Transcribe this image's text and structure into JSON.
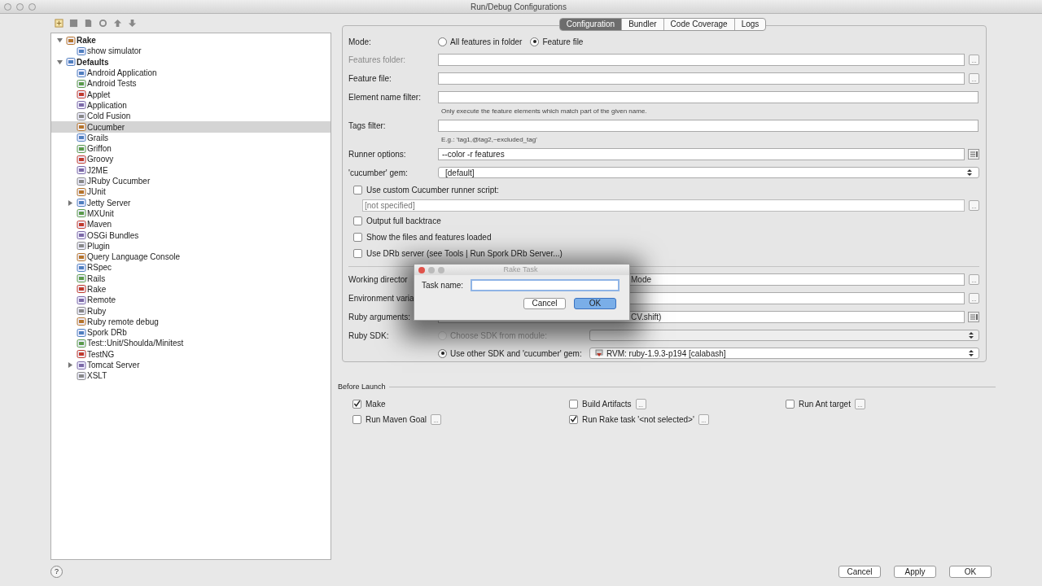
{
  "window": {
    "title": "Run/Debug Configurations"
  },
  "tree": [
    {
      "label": "Rake",
      "kind": "group",
      "expanded": true,
      "bold": true,
      "selected": false,
      "children": [
        {
          "label": "show simulator",
          "kind": "leaf",
          "selected": false
        }
      ]
    },
    {
      "label": "Defaults",
      "kind": "group",
      "expanded": true,
      "bold": true,
      "selected": false,
      "children": [
        {
          "label": "Android Application",
          "kind": "leaf",
          "selected": false
        },
        {
          "label": "Android Tests",
          "kind": "leaf",
          "selected": false
        },
        {
          "label": "Applet",
          "kind": "leaf",
          "selected": false
        },
        {
          "label": "Application",
          "kind": "leaf",
          "selected": false
        },
        {
          "label": "Cold Fusion",
          "kind": "leaf",
          "selected": false
        },
        {
          "label": "Cucumber",
          "kind": "leaf",
          "selected": true
        },
        {
          "label": "Grails",
          "kind": "leaf",
          "selected": false
        },
        {
          "label": "Griffon",
          "kind": "leaf",
          "selected": false
        },
        {
          "label": "Groovy",
          "kind": "leaf",
          "selected": false
        },
        {
          "label": "J2ME",
          "kind": "leaf",
          "selected": false
        },
        {
          "label": "JRuby Cucumber",
          "kind": "leaf",
          "selected": false
        },
        {
          "label": "JUnit",
          "kind": "leaf",
          "selected": false
        },
        {
          "label": "Jetty Server",
          "kind": "group",
          "expanded": false,
          "selected": false
        },
        {
          "label": "MXUnit",
          "kind": "leaf",
          "selected": false
        },
        {
          "label": "Maven",
          "kind": "leaf",
          "selected": false
        },
        {
          "label": "OSGi Bundles",
          "kind": "leaf",
          "selected": false
        },
        {
          "label": "Plugin",
          "kind": "leaf",
          "selected": false
        },
        {
          "label": "Query Language Console",
          "kind": "leaf",
          "selected": false
        },
        {
          "label": "RSpec",
          "kind": "leaf",
          "selected": false
        },
        {
          "label": "Rails",
          "kind": "leaf",
          "selected": false
        },
        {
          "label": "Rake",
          "kind": "leaf",
          "selected": false
        },
        {
          "label": "Remote",
          "kind": "leaf",
          "selected": false
        },
        {
          "label": "Ruby",
          "kind": "leaf",
          "selected": false
        },
        {
          "label": "Ruby remote debug",
          "kind": "leaf",
          "selected": false
        },
        {
          "label": "Spork DRb",
          "kind": "leaf",
          "selected": false
        },
        {
          "label": "Test::Unit/Shoulda/Minitest",
          "kind": "leaf",
          "selected": false
        },
        {
          "label": "TestNG",
          "kind": "leaf",
          "selected": false
        },
        {
          "label": "Tomcat Server",
          "kind": "group",
          "expanded": false,
          "selected": false
        },
        {
          "label": "XSLT",
          "kind": "leaf",
          "selected": false
        }
      ]
    }
  ],
  "tabs": [
    {
      "label": "Configuration",
      "selected": true
    },
    {
      "label": "Bundler",
      "selected": false
    },
    {
      "label": "Code Coverage",
      "selected": false
    },
    {
      "label": "Logs",
      "selected": false
    }
  ],
  "mode": {
    "label": "Mode:",
    "options": [
      {
        "label": "All features in folder",
        "selected": false
      },
      {
        "label": "Feature file",
        "selected": true
      }
    ]
  },
  "rows": [
    {
      "kind": "field",
      "label": "Features folder:",
      "disabled": true,
      "button": "..."
    },
    {
      "kind": "field",
      "label": "Feature file:",
      "disabled": false,
      "button": "..."
    },
    {
      "kind": "field",
      "label": "Element name filter:",
      "disabled": false
    },
    {
      "kind": "hint",
      "text": "Only execute the feature elements which match part of the given name."
    },
    {
      "kind": "field",
      "label": "Tags filter:",
      "disabled": false
    },
    {
      "kind": "hint",
      "text": "E.g.: 'tag1,@tag2,~excluded_tag'"
    },
    {
      "kind": "field",
      "label": "Runner options:",
      "disabled": false,
      "value": "--color -r features",
      "expand": true
    },
    {
      "kind": "select",
      "label": "'cucumber' gem:",
      "value": "[default]"
    },
    {
      "kind": "checkbox",
      "label": "Use custom Cucumber runner script:",
      "checked": false
    },
    {
      "kind": "script",
      "placeholder": "[not specified]",
      "button": "..."
    },
    {
      "kind": "checkbox",
      "label": "Output full backtrace",
      "checked": false
    },
    {
      "kind": "checkbox",
      "label": "Show the files and features loaded",
      "checked": false
    },
    {
      "kind": "checkbox",
      "label": "Use DRb server (see Tools | Run Spork DRb Server...)",
      "checked": false
    }
  ],
  "lower_rows": [
    {
      "kind": "field",
      "label": "Working director",
      "value": "Mode",
      "button": "..."
    },
    {
      "kind": "field",
      "label": "Environment varia",
      "button": "..."
    },
    {
      "kind": "field",
      "label": "Ruby arguments:",
      "value": "CV.shift)",
      "expand": true
    }
  ],
  "sdk": {
    "label": "Ruby SDK:",
    "options": [
      {
        "label": "Choose SDK from module:",
        "selected": false
      },
      {
        "label": "Use other SDK and 'cucumber' gem:",
        "selected": true,
        "value": "RVM: ruby-1.9.3-p194 [calabash]"
      }
    ]
  },
  "dialog": {
    "title": "Rake Task",
    "label": "Task name:",
    "buttons": [
      {
        "label": "Cancel",
        "default": false
      },
      {
        "label": "OK",
        "default": true
      }
    ]
  },
  "before_launch": {
    "title": "Before Launch",
    "items": [
      {
        "label": "Make",
        "checked": true
      },
      {
        "label": "Build Artifacts",
        "checked": false,
        "button": "..."
      },
      {
        "label": "Run Ant target",
        "checked": false,
        "button": "..."
      },
      {
        "label": "Run Maven Goal",
        "checked": false,
        "button": "..."
      },
      {
        "label": "Run Rake task '<not selected>'",
        "checked": true,
        "button": "..."
      }
    ]
  },
  "help": "?",
  "footer_buttons": [
    {
      "label": "Cancel",
      "default": false
    },
    {
      "label": "Apply",
      "default": false
    },
    {
      "label": "OK",
      "default": false
    }
  ]
}
